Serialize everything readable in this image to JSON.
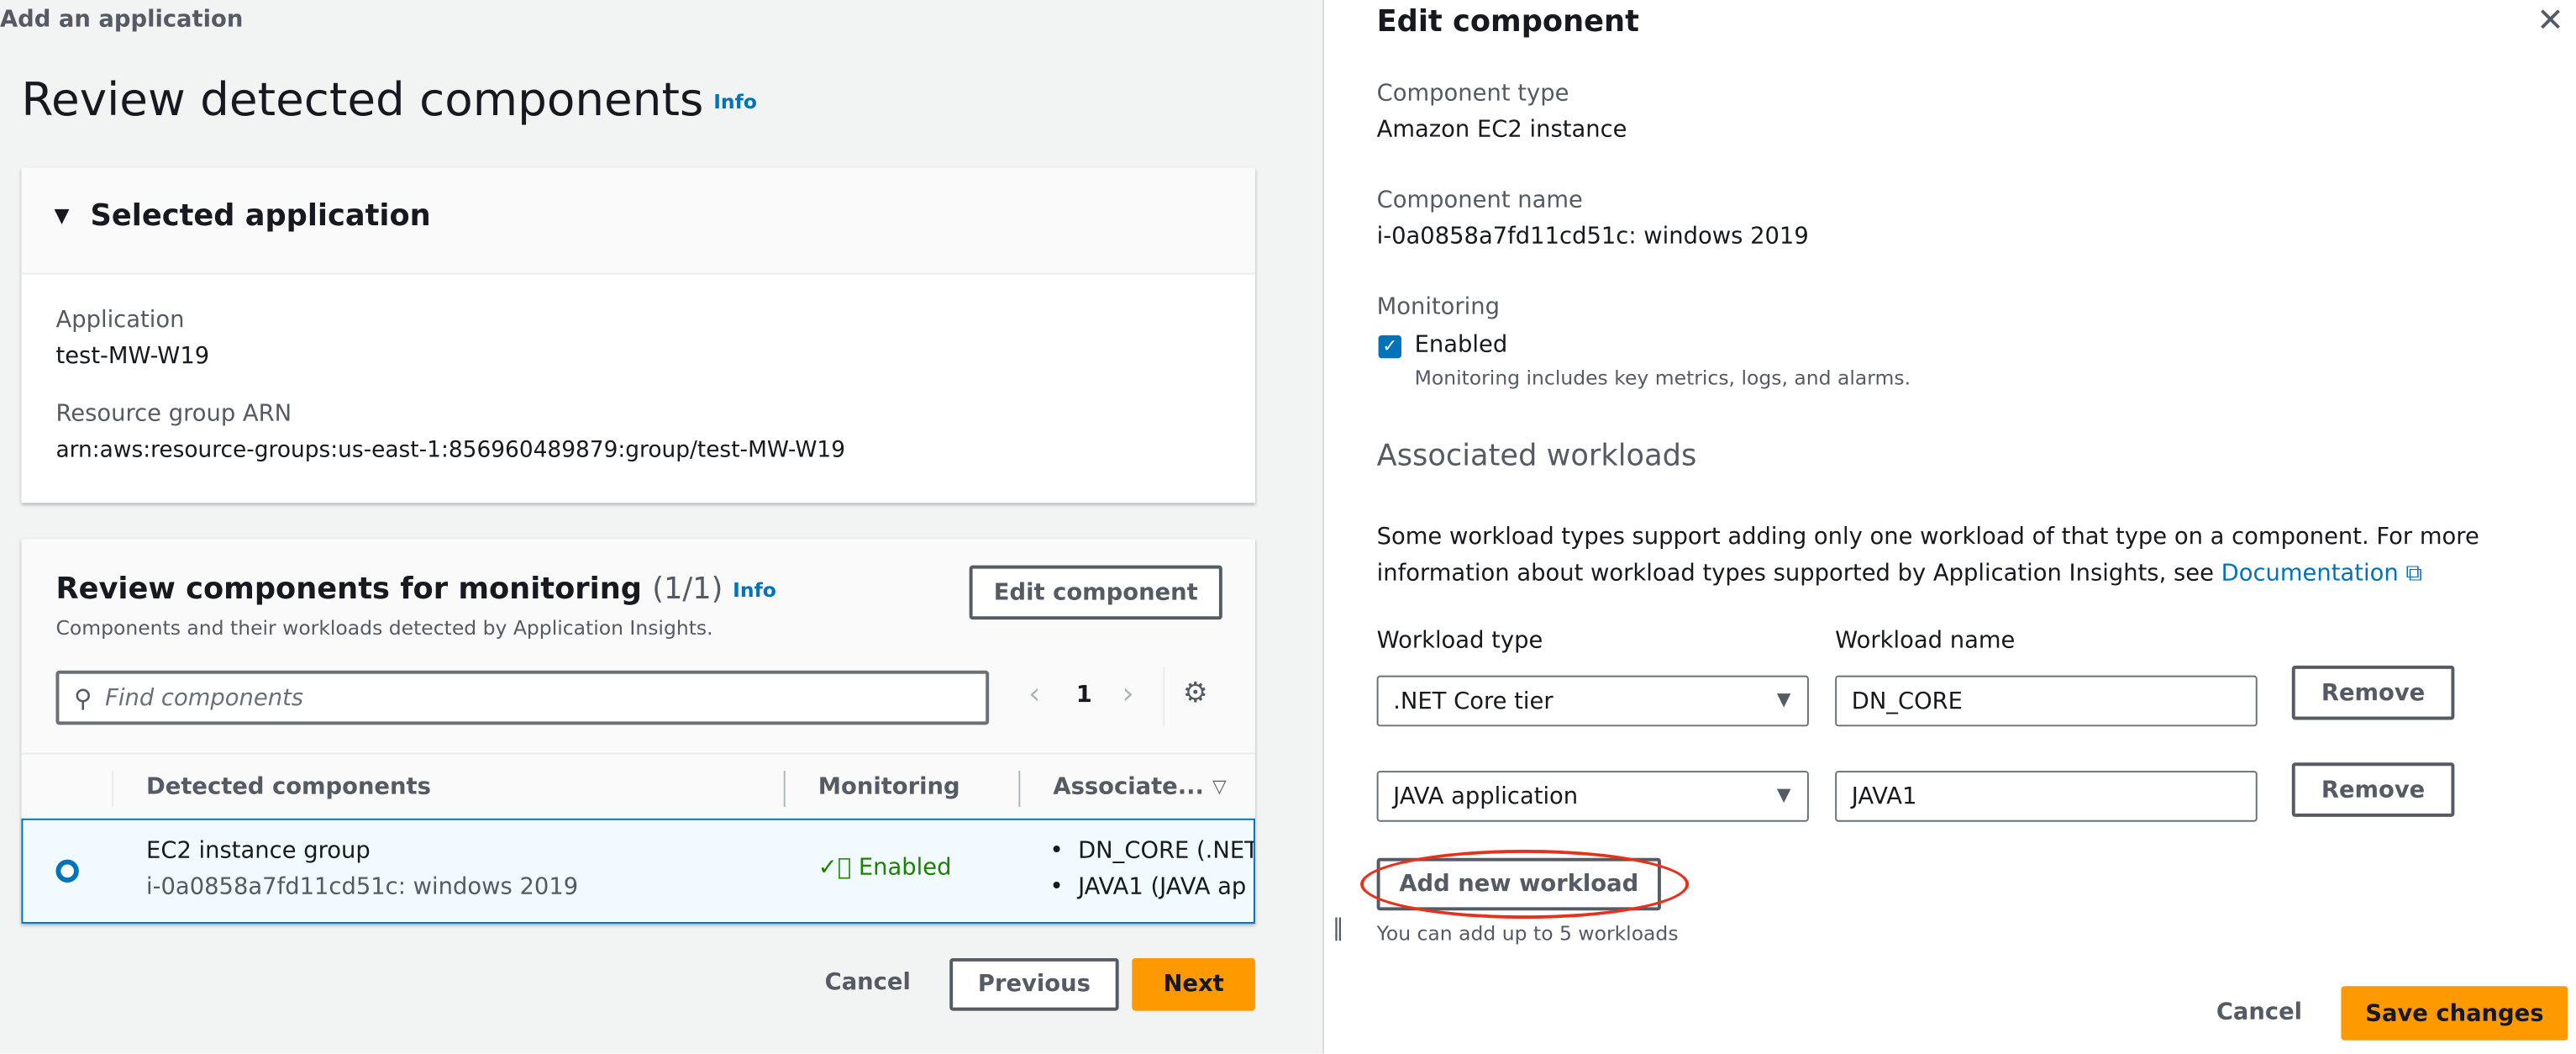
{
  "breadcrumb": "Add an application",
  "page": {
    "title": "Review detected components",
    "info": "Info"
  },
  "selected_application": {
    "header": "Selected application",
    "application_label": "Application",
    "application_value": "test-MW-W19",
    "arn_label": "Resource group ARN",
    "arn_value": "arn:aws:resource-groups:us-east-1:856960489879:group/test-MW-W19"
  },
  "review": {
    "title": "Review components for monitoring",
    "count": "(1/1)",
    "info": "Info",
    "description": "Components and their workloads detected by Application Insights.",
    "edit_button": "Edit component",
    "search_placeholder": "Find components",
    "page_number": "1",
    "columns": [
      "Detected components",
      "Monitoring",
      "Associate..."
    ],
    "rows": [
      {
        "name": "EC2 instance group",
        "id": "i-0a0858a7fd11cd51c: windows 2019",
        "monitoring": "Enabled",
        "workloads": [
          "DN_CORE (.NET",
          "JAVA1 (JAVA ap"
        ],
        "selected": true
      }
    ]
  },
  "footer": {
    "cancel": "Cancel",
    "previous": "Previous",
    "next": "Next"
  },
  "edit_panel": {
    "title": "Edit component",
    "component_type_label": "Component type",
    "component_type_value": "Amazon EC2 instance",
    "component_name_label": "Component name",
    "component_name_value": "i-0a0858a7fd11cd51c: windows 2019",
    "monitoring_label": "Monitoring",
    "monitoring_checkbox": "Enabled",
    "monitoring_checked": true,
    "monitoring_hint": "Monitoring includes key metrics, logs, and alarms.",
    "workloads_header": "Associated workloads",
    "workloads_description": "Some workload types support adding only one workload of that type on a component. For more information about workload types supported by Application Insights, see",
    "documentation_link": "Documentation",
    "workload_type_label": "Workload type",
    "workload_name_label": "Workload name",
    "workloads": [
      {
        "type": ".NET Core tier",
        "name": "DN_CORE",
        "remove": "Remove"
      },
      {
        "type": "JAVA application",
        "name": "JAVA1",
        "remove": "Remove"
      }
    ],
    "add_workload": "Add new workload",
    "add_hint": "You can add up to 5 workloads",
    "cancel": "Cancel",
    "save": "Save changes"
  },
  "colors": {
    "accent": "#ff9900",
    "link": "#0073bb",
    "success": "#1d8102",
    "annotation": "#e8311a"
  }
}
